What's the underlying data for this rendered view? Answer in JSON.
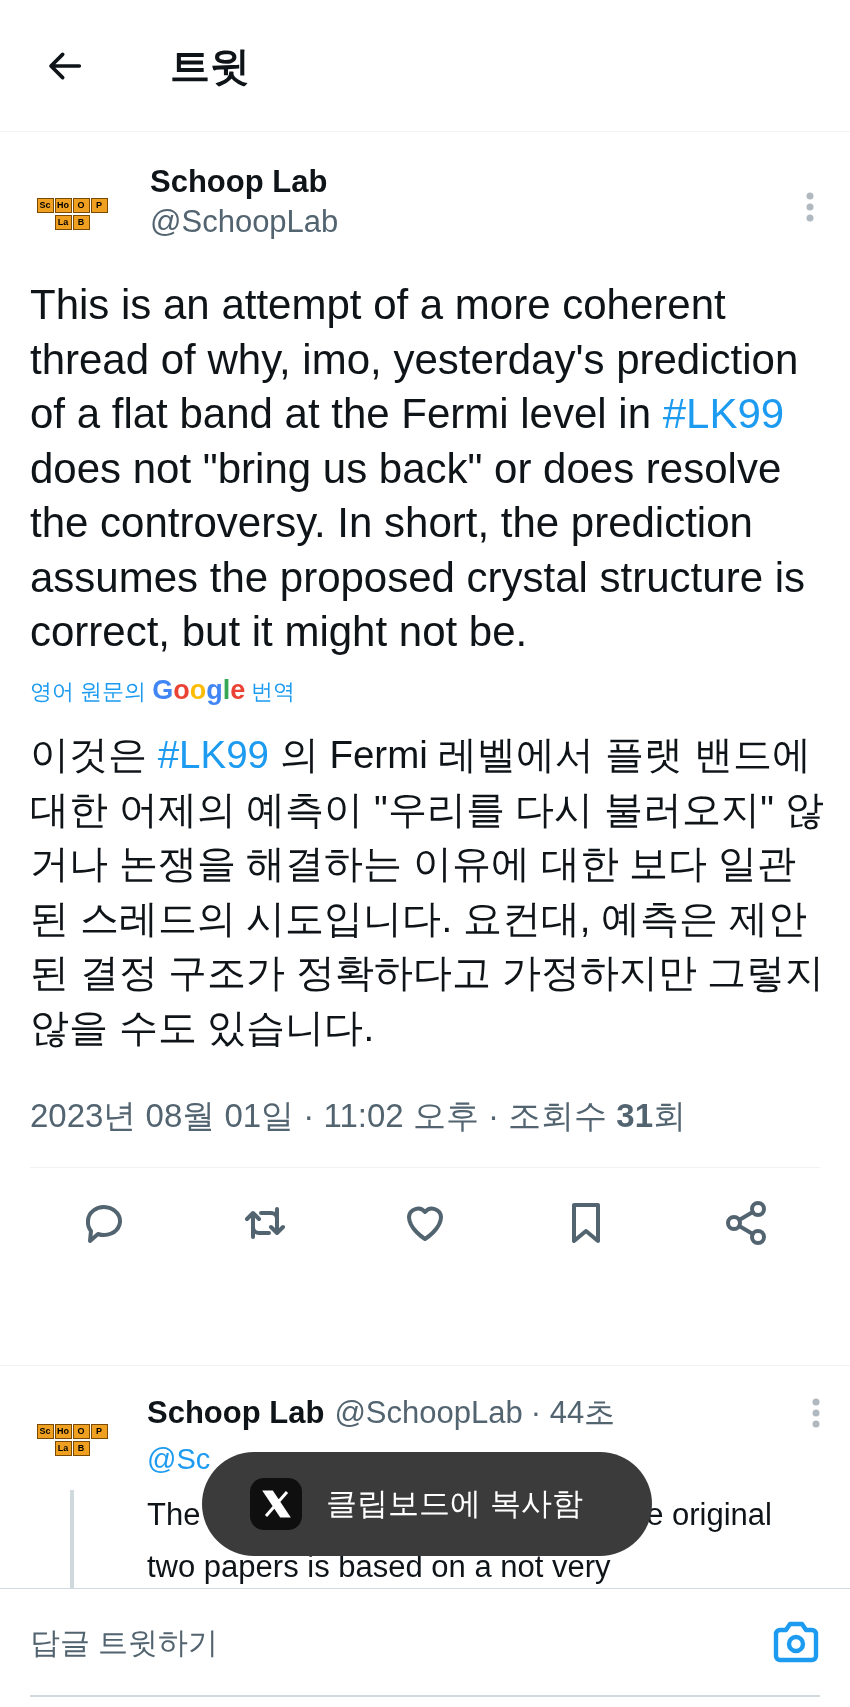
{
  "header": {
    "title": "트윗"
  },
  "tweet": {
    "author": {
      "name": "Schoop Lab",
      "handle": "@SchoopLab",
      "avatar_tiles": [
        "Sc",
        "Ho",
        "O",
        "P",
        "La",
        "B"
      ]
    },
    "body": [
      {
        "kind": "text",
        "text": "This is an attempt of a more coherent thread of why, imo, yesterday's prediction of a flat band at the Fermi level in "
      },
      {
        "kind": "hashtag",
        "text": "#LK99"
      },
      {
        "kind": "text",
        "text": " does not \"bring us back\" or does resolve the controversy. In short, the prediction assumes the proposed crystal structure is correct, but it might not be."
      }
    ],
    "translation_label": {
      "before": "영어 원문의 ",
      "brand": "Google",
      "after": " 번역"
    },
    "translation": [
      {
        "kind": "text",
        "text": "이것은 "
      },
      {
        "kind": "hashtag",
        "text": "#LK99"
      },
      {
        "kind": "text",
        "text": " 의 Fermi 레벨에서 플랫 밴드에 대한 어제의 예측이 \"우리를 다시 불러오지\" 않거나 논쟁을 해결하는 이유에 대한 보다 일관된 스레드의 시도입니다. 요컨대, 예측은 제안된 결정 구조가 정확하다고 가정하지만 그렇지 않을 수도 있습니다."
      }
    ],
    "meta": "2023년 08월 01일 · 11:02 오후 · 조회수 **31**회"
  },
  "reply": {
    "avatar_tiles": [
      "Sc",
      "Ho",
      "O",
      "P",
      "La",
      "B"
    ],
    "name": "Schoop Lab",
    "handle": "@SchoopLab",
    "time": "· 44초",
    "reply_to": {
      "handle": "@Sc"
    },
    "text_line1": [
      "The",
      "e original"
    ],
    "text_line2": "two papers is based on a not very"
  },
  "toast": {
    "text": "클립보드에 복사함"
  },
  "composer": {
    "placeholder": "답글 트윗하기"
  }
}
